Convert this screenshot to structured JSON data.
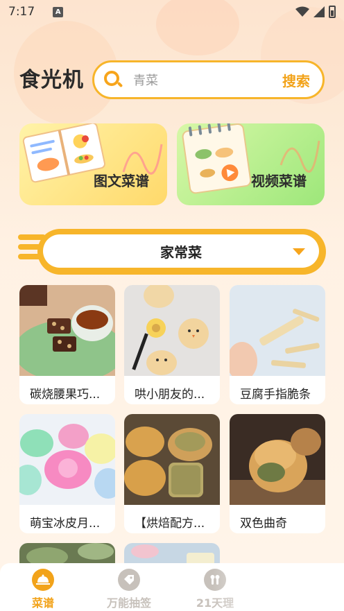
{
  "status_bar": {
    "time": "7:17",
    "notif_letter": "A"
  },
  "header": {
    "logo": "食光机",
    "search_placeholder": "青菜",
    "search_button": "搜索"
  },
  "features": [
    {
      "label": "图文菜谱",
      "icon": "recipe-book-icon"
    },
    {
      "label": "视频菜谱",
      "icon": "video-notebook-icon"
    }
  ],
  "category": {
    "selected": "家常菜"
  },
  "recipes": [
    {
      "name": "碳烧腰果巧..."
    },
    {
      "name": "哄小朋友的..."
    },
    {
      "name": "豆腐手指脆条"
    },
    {
      "name": "萌宝冰皮月..."
    },
    {
      "name": "【烘焙配方..."
    },
    {
      "name": "双色曲奇"
    }
  ],
  "nav": {
    "items": [
      {
        "label": "菜谱",
        "icon": "cloche-icon",
        "active": true
      },
      {
        "label": "万能抽签",
        "icon": "tag-icon",
        "active": false
      },
      {
        "label": "21天理",
        "icon": "tools-icon",
        "active": false
      }
    ]
  },
  "colors": {
    "accent": "#f7b52a",
    "active_nav": "#f2a31a",
    "inactive_nav": "#c7c1bb"
  }
}
